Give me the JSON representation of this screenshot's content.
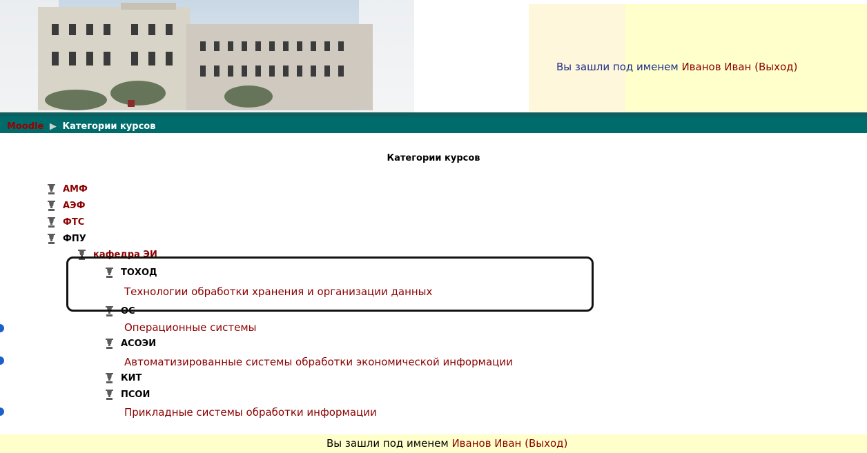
{
  "header": {
    "login_prefix": "Вы зашли под именем",
    "user_name": "Иванов Иван",
    "logout": "(Выход)"
  },
  "nav": {
    "home": "Moodle",
    "separator": "▶",
    "current": "Категории курсов"
  },
  "main": {
    "title": "Категории курсов",
    "categories": [
      {
        "label": "АМФ"
      },
      {
        "label": "АЭФ"
      },
      {
        "label": "ФТС"
      },
      {
        "label": "ФПУ"
      },
      {
        "label": "кафедра ЭИ"
      },
      {
        "label": "ТОХОД",
        "course": "Технологии обработки хранения и организации данных"
      },
      {
        "label": "ОС",
        "course": "Операционные системы"
      },
      {
        "label": "АСОЭИ",
        "course": "Автоматизированные системы обработки экономической информации"
      },
      {
        "label": "КИТ"
      },
      {
        "label": "ПСОИ",
        "course": "Прикладные системы обработки информации"
      }
    ]
  },
  "footer": {
    "login_prefix": "Вы зашли под именем",
    "user_name": "Иванов Иван",
    "logout": "(Выход)"
  },
  "colors": {
    "nav_bg": "#006b6b",
    "link": "#8b0000",
    "panel_yellow": "#ffffcc"
  },
  "icons": {
    "category": "folder-tree-icon",
    "status": "blue-dot-icon"
  }
}
